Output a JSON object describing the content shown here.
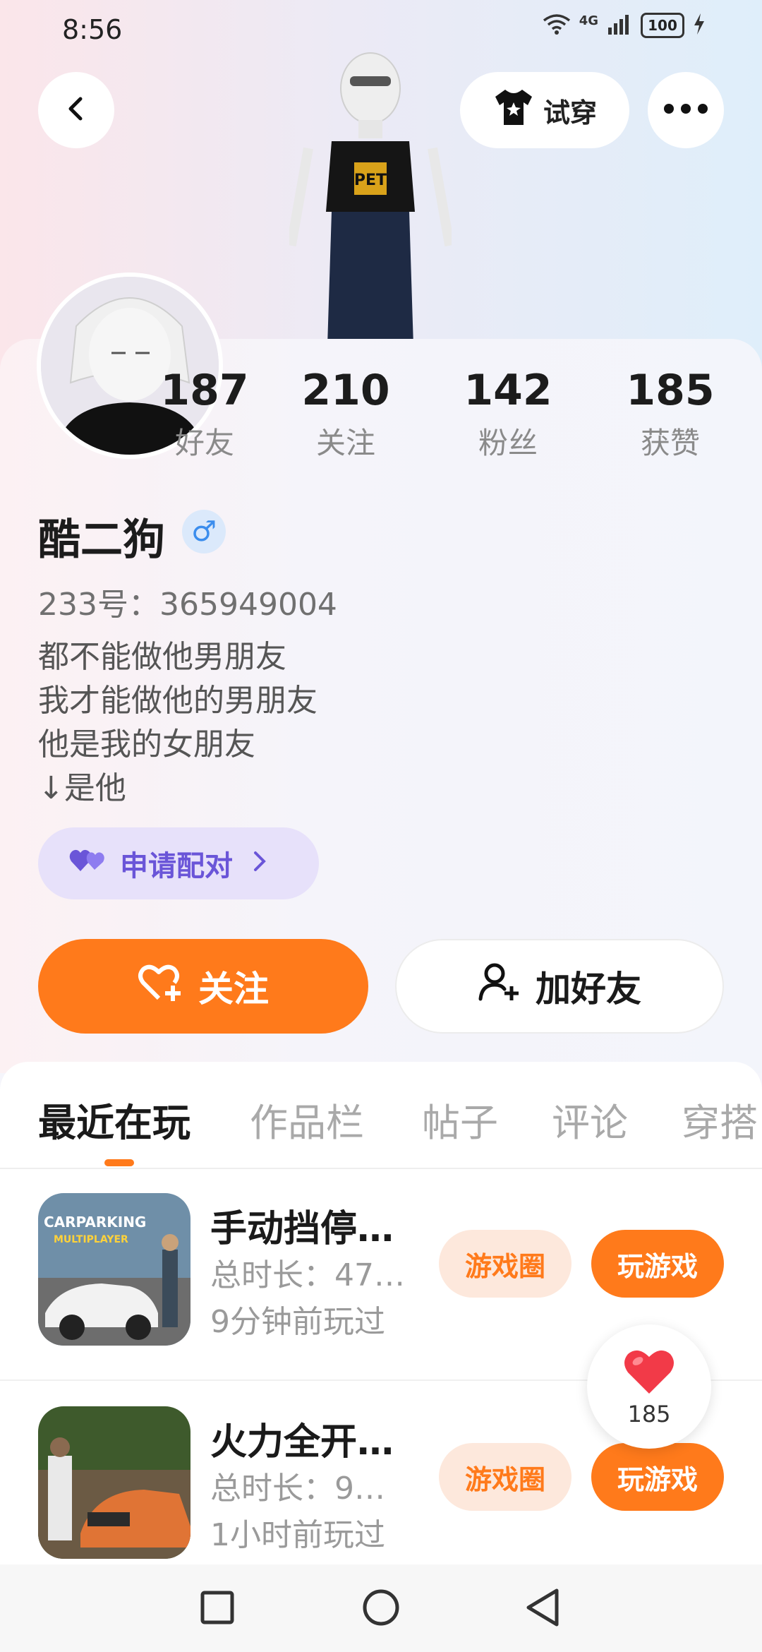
{
  "status_bar": {
    "time": "8:56",
    "network": "4G",
    "battery": "100"
  },
  "header": {
    "try_on_label": "试穿"
  },
  "stats": [
    {
      "value": "187",
      "label": "好友"
    },
    {
      "value": "210",
      "label": "关注"
    },
    {
      "value": "142",
      "label": "粉丝"
    },
    {
      "value": "185",
      "label": "获赞"
    }
  ],
  "profile": {
    "name": "酷二狗",
    "gender_symbol": "♂",
    "uid": "233号：365949004",
    "bio": [
      "都不能做他男朋友",
      "我才能做他的男朋友",
      "他是我的女朋友",
      "↓是他"
    ],
    "match_label": "申请配对"
  },
  "actions": {
    "follow_label": "关注",
    "add_friend_label": "加好友"
  },
  "tabs": [
    {
      "label": "最近在玩",
      "active": true
    },
    {
      "label": "作品栏",
      "active": false
    },
    {
      "label": "帖子",
      "active": false
    },
    {
      "label": "评论",
      "active": false
    },
    {
      "label": "穿搭",
      "active": false
    }
  ],
  "games": [
    {
      "title": "手动挡停…",
      "duration": "总时长：47…",
      "last_played": "9分钟前玩过",
      "circle_label": "游戏圈",
      "play_label": "玩游戏",
      "thumb_text_1": "CARPARKING",
      "thumb_text_2": "MULTIPLAYER"
    },
    {
      "title": "火力全开…",
      "duration": "总时长：9…",
      "last_played": "1小时前玩过",
      "circle_label": "游戏圈",
      "play_label": "玩游戏"
    }
  ],
  "likes": {
    "count": "185"
  },
  "colors": {
    "accent": "#ff7a1b",
    "match_purple": "#6a55d8",
    "gender_blue": "#3b8ded"
  }
}
